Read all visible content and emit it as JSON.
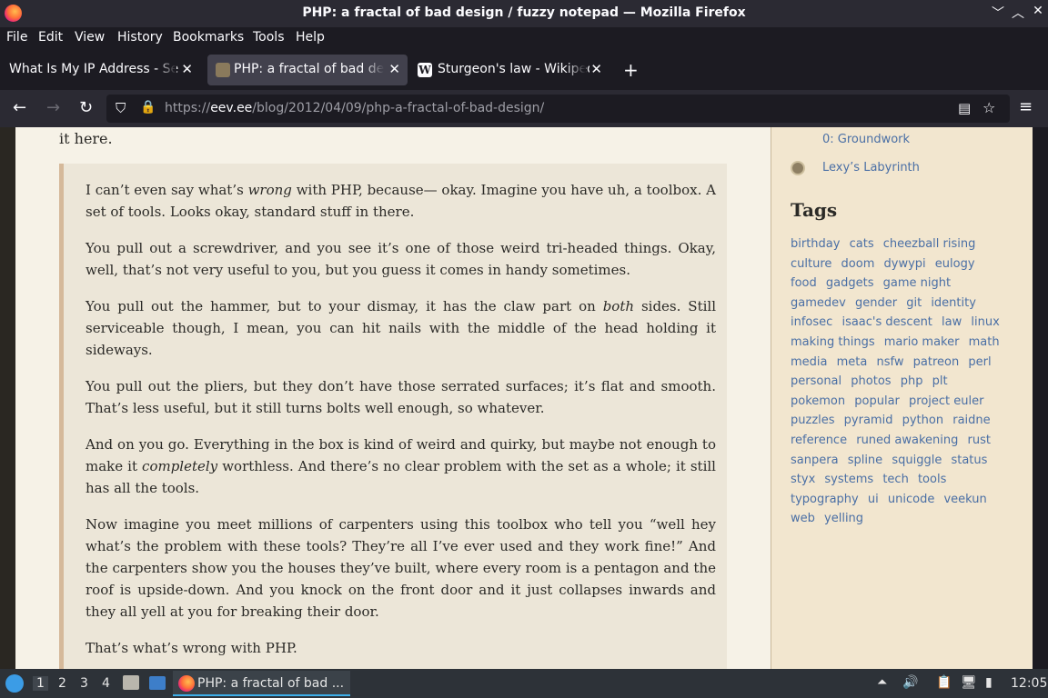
{
  "window": {
    "title": "PHP: a fractal of bad design / fuzzy notepad — Mozilla Firefox",
    "controls": [
      "minimize",
      "maximize",
      "close"
    ]
  },
  "menubar": {
    "items": [
      "File",
      "Edit",
      "View",
      "History",
      "Bookmarks",
      "Tools",
      "Help"
    ]
  },
  "tabs": [
    {
      "label": "What Is My IP Address - See",
      "active": false,
      "favicon": "none"
    },
    {
      "label": "PHP: a fractal of bad desi",
      "active": true,
      "favicon": "owl-icon"
    },
    {
      "label": "Sturgeon's law - Wikipedi",
      "active": false,
      "favicon": "wikipedia-icon"
    }
  ],
  "navbar": {
    "url_prefix": "https://",
    "url_host": "eev.ee",
    "url_path": "/blog/2012/04/09/php-a-fractal-of-bad-design/"
  },
  "article": {
    "intro": "it here.",
    "quote_paragraphs": [
      "I can’t even say what’s wrong with PHP, because— okay. Imagine you have uh, a toolbox. A set of tools. Looks okay, standard stuff in there.",
      "You pull out a screwdriver, and you see it’s one of those weird tri-headed things. Okay, well, that’s not very useful to you, but you guess it comes in handy sometimes.",
      "You pull out the hammer, but to your dismay, it has the claw part on both sides. Still serviceable though, I mean, you can hit nails with the middle of the head holding it sideways.",
      "You pull out the pliers, but they don’t have those serrated surfaces; it’s flat and smooth. That’s less useful, but it still turns bolts well enough, so whatever.",
      "And on you go. Everything in the box is kind of weird and quirky, but maybe not enough to make it completely worthless. And there’s no clear problem with the set as a whole; it still has all the tools.",
      "Now imagine you meet millions of carpenters using this toolbox who tell you “well hey what’s the problem with these tools? They’re all I’ve ever used and they work fine!” And the carpenters show you the houses they’ve built, where every room is a pentagon and the roof is upside-down. And you knock on the front door and it just collapses inwards and they all yell at you for breaking their door.",
      "That’s what’s wrong with PHP."
    ]
  },
  "sidebar": {
    "links": [
      "0: Groundwork",
      "Lexy’s Labyrinth"
    ],
    "tags_heading": "Tags",
    "tags": [
      "birthday",
      "cats",
      "cheezball rising",
      "culture",
      "doom",
      "dywypi",
      "eulogy",
      "food",
      "gadgets",
      "game night",
      "gamedev",
      "gender",
      "git",
      "identity",
      "infosec",
      "isaac's descent",
      "law",
      "linux",
      "making things",
      "mario maker",
      "math",
      "media",
      "meta",
      "nsfw",
      "patreon",
      "perl",
      "personal",
      "photos",
      "php",
      "plt",
      "pokemon",
      "popular",
      "project euler",
      "puzzles",
      "pyramid",
      "python",
      "raidne",
      "reference",
      "runed awakening",
      "rust",
      "sanpera",
      "spline",
      "squiggle",
      "status",
      "styx",
      "systems",
      "tech",
      "tools",
      "typography",
      "ui",
      "unicode",
      "veekun",
      "web",
      "yelling"
    ]
  },
  "taskbar": {
    "workspaces": [
      "1",
      "2",
      "3",
      "4"
    ],
    "active_workspace": "1",
    "app_label": "PHP: a fractal of bad ...",
    "clock": "12:05"
  }
}
